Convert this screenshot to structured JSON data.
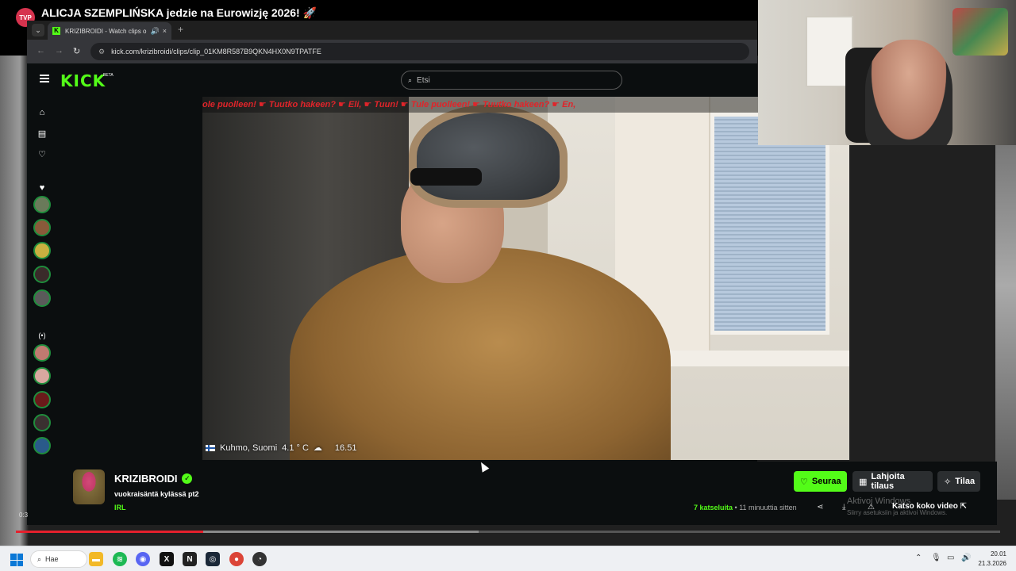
{
  "outer": {
    "headline": "ALICJA SZEMPLIŃSKA jedzie na Eurowizję 2026! 🚀",
    "channel_logo": "TVP",
    "progress_fraction": 0.19,
    "buffer_fraction": 0.47,
    "time_fragment": "0:3"
  },
  "browser": {
    "tab_title": "KRIZIBROIDI - Watch clips o",
    "url": "kick.com/krizibroidi/clips/clip_01KM8R587B9QKN4HX0N9TPATFE"
  },
  "kick": {
    "logo": "KICK",
    "beta": "BETA",
    "search_placeholder": "Etsi"
  },
  "video": {
    "ticker": "ole puolleen!   ☛  Tuutko hakeen?   ☛  Eli,   ☛  Tuun!   ☛  Tule puolleen!   ☛  Tuutko hakeen?   ☛  En,",
    "location": "Kuhmo, Suomi",
    "temperature": "4.1 ° C",
    "time": "16.51"
  },
  "channel": {
    "name": "KRIZIBROIDI",
    "clip_title": "vuokraisäntä kylässä pt2",
    "category": "IRL",
    "views": "7 katseluita",
    "age": "11 minuuttia sitten"
  },
  "actions": {
    "follow": "Seuraa",
    "gift": "Lahjoita tilaus",
    "subscribe": "Tilaa",
    "full_video": "Katso koko video"
  },
  "windows_watermark": {
    "line1": "Aktivoi Windows",
    "line2": "Siirry asetuksiin ja aktivoi Windows."
  },
  "taskbar": {
    "search_label": "Hae",
    "time": "20.01",
    "date": "21.3.2026"
  },
  "colors": {
    "kick_green": "#53fc18",
    "ticker_red": "#e0242a",
    "progress_red": "#e5202d"
  }
}
